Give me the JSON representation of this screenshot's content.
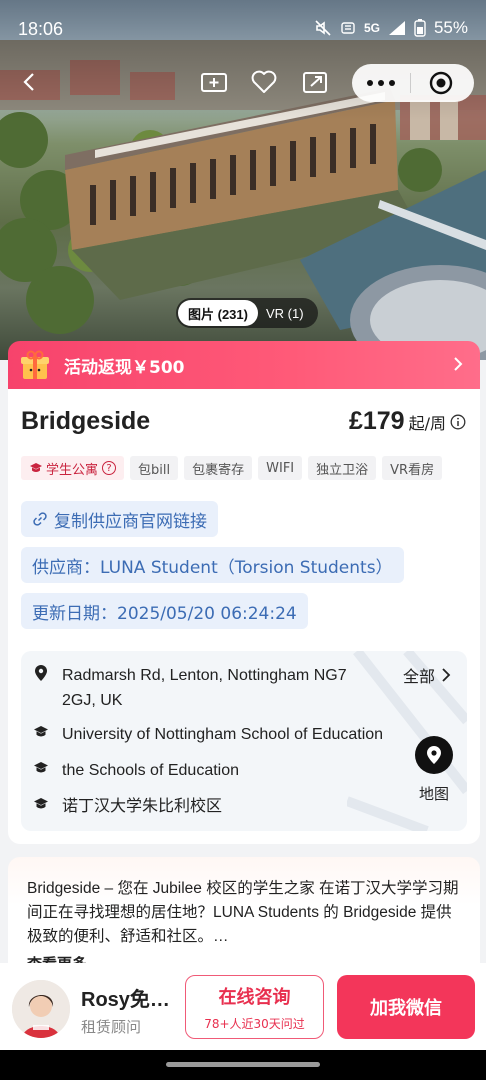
{
  "status_bar": {
    "time": "18:06",
    "network": "5G",
    "battery": "55%"
  },
  "media_toggle": {
    "photos_label": "图片 (231)",
    "vr_label": "VR (1)"
  },
  "promo": {
    "text": "活动返现￥500"
  },
  "listing": {
    "title": "Bridgeside",
    "price": "£179",
    "price_unit": "起/周",
    "tags": [
      "学生公寓",
      "包bill",
      "包裹寄存",
      "WIFI",
      "独立卫浴",
      "VR看房"
    ],
    "copy_link_label": "复制供应商官网链接",
    "supplier": "供应商：LUNA Student（Torsion Students）",
    "updated": "更新日期：2025/05/20 06:24:24"
  },
  "location": {
    "address": "Radmarsh Rd, Lenton, Nottingham NG7 2GJ, UK",
    "schools": [
      "University of Nottingham School of Education",
      "the Schools of Education",
      "诺丁汉大学朱比利校区"
    ],
    "all_label": "全部",
    "map_label": "地图"
  },
  "description": {
    "text": "Bridgeside – 您在 Jubilee 校区的学生之家 在诺丁汉大学学习期间正在寻找理想的居住地？LUNA Students 的 Bridgeside 提供极致的便利、舒适和社区。…",
    "more_label": "查看更多"
  },
  "agent": {
    "name": "Rosy免…",
    "role": "租赁顾问"
  },
  "actions": {
    "consult_label": "在线咨询",
    "consult_sub": "78+人近30天问过",
    "wechat_label": "加我微信"
  },
  "colors": {
    "accent": "#f3365a",
    "link_blue": "#3c6cb4",
    "chip_bg": "#e9f0fb"
  }
}
